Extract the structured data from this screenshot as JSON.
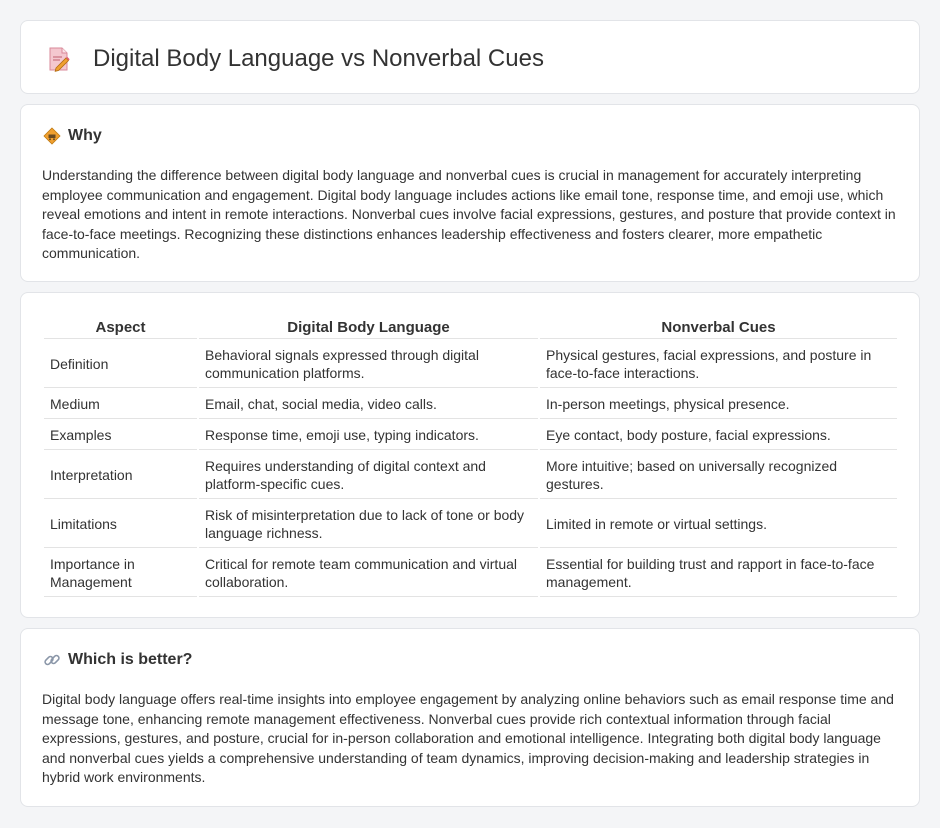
{
  "header": {
    "title": "Digital Body Language vs Nonverbal Cues",
    "icon": "document-pencil-icon"
  },
  "why": {
    "title": "Why",
    "icon": "warning-diamond-icon",
    "body": "Understanding the difference between digital body language and nonverbal cues is crucial in management for accurately interpreting employee communication and engagement. Digital body language includes actions like email tone, response time, and emoji use, which reveal emotions and intent in remote interactions. Nonverbal cues involve facial expressions, gestures, and posture that provide context in face-to-face meetings. Recognizing these distinctions enhances leadership effectiveness and fosters clearer, more empathetic communication."
  },
  "table": {
    "headers": [
      "Aspect",
      "Digital Body Language",
      "Nonverbal Cues"
    ],
    "rows": [
      [
        "Definition",
        "Behavioral signals expressed through digital communication platforms.",
        "Physical gestures, facial expressions, and posture in face-to-face interactions."
      ],
      [
        "Medium",
        "Email, chat, social media, video calls.",
        "In-person meetings, physical presence."
      ],
      [
        "Examples",
        "Response time, emoji use, typing indicators.",
        "Eye contact, body posture, facial expressions."
      ],
      [
        "Interpretation",
        "Requires understanding of digital context and platform-specific cues.",
        "More intuitive; based on universally recognized gestures."
      ],
      [
        "Limitations",
        "Risk of misinterpretation due to lack of tone or body language richness.",
        "Limited in remote or virtual settings."
      ],
      [
        "Importance in Management",
        "Critical for remote team communication and virtual collaboration.",
        "Essential for building trust and rapport in face-to-face management."
      ]
    ]
  },
  "better": {
    "title": "Which is better?",
    "icon": "link-icon",
    "body": "Digital body language offers real-time insights into employee engagement by analyzing online behaviors such as email response time and message tone, enhancing remote management effectiveness. Nonverbal cues provide rich contextual information through facial expressions, gestures, and posture, crucial for in-person collaboration and emotional intelligence. Integrating both digital body language and nonverbal cues yields a comprehensive understanding of team dynamics, improving decision-making and leadership strategies in hybrid work environments."
  },
  "colors": {
    "accent": "#f0a030",
    "icon_pink": "#e8889a",
    "card_border": "#e2e4e8",
    "background": "#f4f5f7"
  }
}
